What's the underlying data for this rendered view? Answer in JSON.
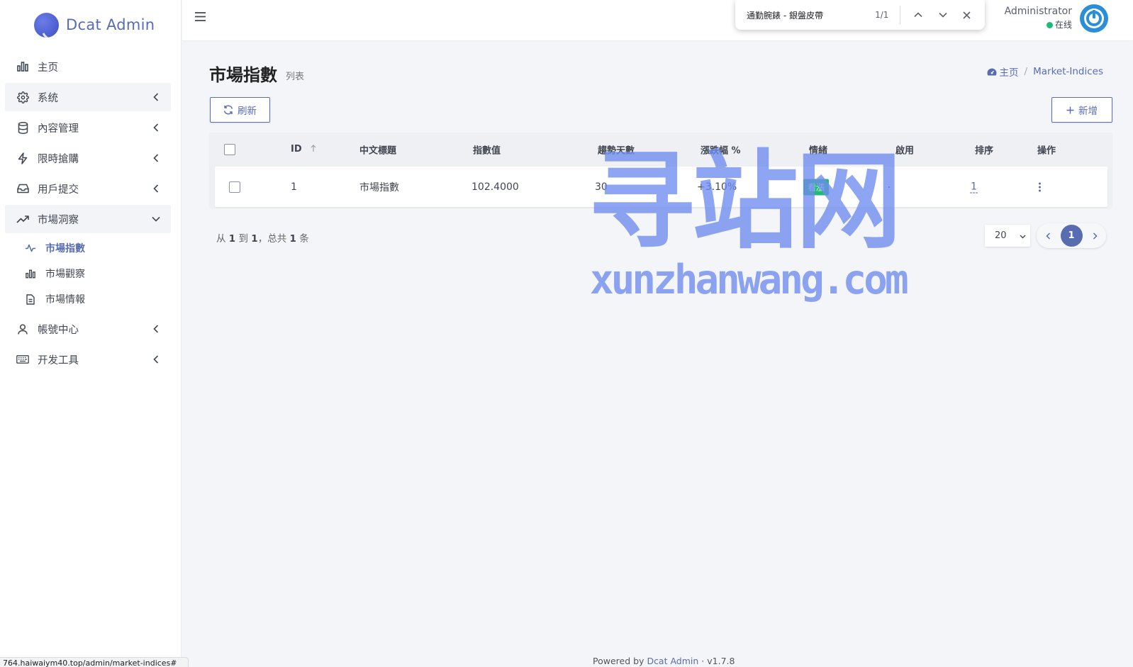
{
  "brand": {
    "name": "Dcat Admin"
  },
  "sidebar": {
    "items": [
      {
        "label": "主页",
        "icon": "bar-chart-icon"
      },
      {
        "label": "系统",
        "icon": "gear-icon"
      },
      {
        "label": "內容管理",
        "icon": "database-icon"
      },
      {
        "label": "限時搶購",
        "icon": "lightning-icon"
      },
      {
        "label": "用戶提交",
        "icon": "inbox-icon"
      },
      {
        "label": "市場洞察",
        "icon": "trending-up-icon"
      },
      {
        "label": "帳號中心",
        "icon": "user-icon"
      },
      {
        "label": "开发工具",
        "icon": "keyboard-icon"
      }
    ],
    "submenu": [
      {
        "label": "市場指數",
        "icon": "activity-icon",
        "active": true
      },
      {
        "label": "市場觀察",
        "icon": "bar-chart-icon"
      },
      {
        "label": "市場情報",
        "icon": "file-text-icon"
      }
    ]
  },
  "findbar": {
    "query": "通勤腕錶 - 銀盤皮帶",
    "count": "1/1"
  },
  "user": {
    "name": "Administrator",
    "status": "在线"
  },
  "page": {
    "title": "市場指數",
    "subtitle": "列表"
  },
  "breadcrumb": {
    "home": "主页",
    "current": "Market-Indices"
  },
  "toolbar": {
    "refresh_label": "刷新",
    "new_label": "新增"
  },
  "table": {
    "headers": [
      "ID",
      "中文標題",
      "指數值",
      "趨勢天數",
      "漲跌幅 %",
      "情緒",
      "啟用",
      "排序",
      "操作"
    ],
    "rows": [
      {
        "id": "1",
        "title": "市場指數",
        "value": "102.4000",
        "days": "30",
        "change": "+3.10%",
        "sentiment": "看漲",
        "enabled": true,
        "order": "1"
      }
    ]
  },
  "pagination": {
    "summary_from": "从",
    "from": "1",
    "summary_to": "到",
    "to": "1",
    "summary_total": "，总共",
    "total": "1",
    "summary_unit": "条",
    "per_page": "20",
    "current_page": "1"
  },
  "footer": {
    "powered": "Powered by",
    "link": "Dcat Admin",
    "version": "· v1.7.8"
  },
  "status_url": "764.haiwaiym40.top/admin/market-indices#",
  "watermark": {
    "main": "寻站网",
    "sub": "xunzhanwang.com"
  },
  "colors": {
    "primary": "#586cb1",
    "success": "#21b978",
    "sidebar_bg": "#ffffff",
    "content_bg": "#f4f5f9"
  }
}
